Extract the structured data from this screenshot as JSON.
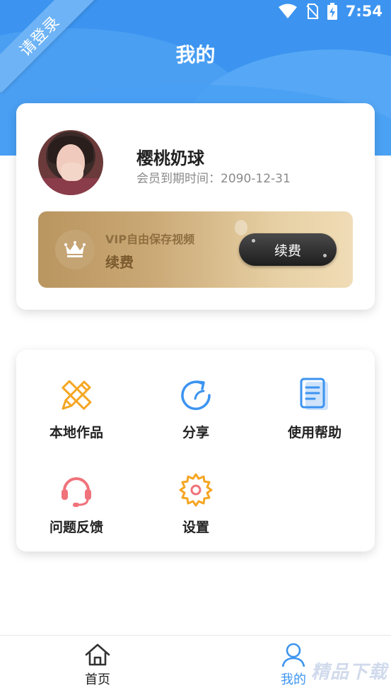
{
  "status_bar": {
    "time": "7:54"
  },
  "header": {
    "ribbon_text": "请登录",
    "title": "我的"
  },
  "profile": {
    "name": "樱桃奶球",
    "expiry_text": "会员到期时间：2090-12-31"
  },
  "vip": {
    "title": "VIP自由保存视频",
    "subtitle": "续费",
    "button_label": "续费"
  },
  "menu": {
    "items": [
      {
        "label": "本地作品",
        "icon": "pencil-ruler-icon"
      },
      {
        "label": "分享",
        "icon": "share-refresh-icon"
      },
      {
        "label": "使用帮助",
        "icon": "document-icon"
      },
      {
        "label": "问题反馈",
        "icon": "headset-icon"
      },
      {
        "label": "设置",
        "icon": "gear-icon"
      }
    ]
  },
  "bottom_nav": {
    "home_label": "首页",
    "mine_label": "我的"
  },
  "watermark": {
    "text": "精品下载"
  },
  "colors": {
    "primary": "#3c94f0",
    "orange": "#f5a623",
    "red": "#f0727a",
    "gold": "#c5a474"
  }
}
